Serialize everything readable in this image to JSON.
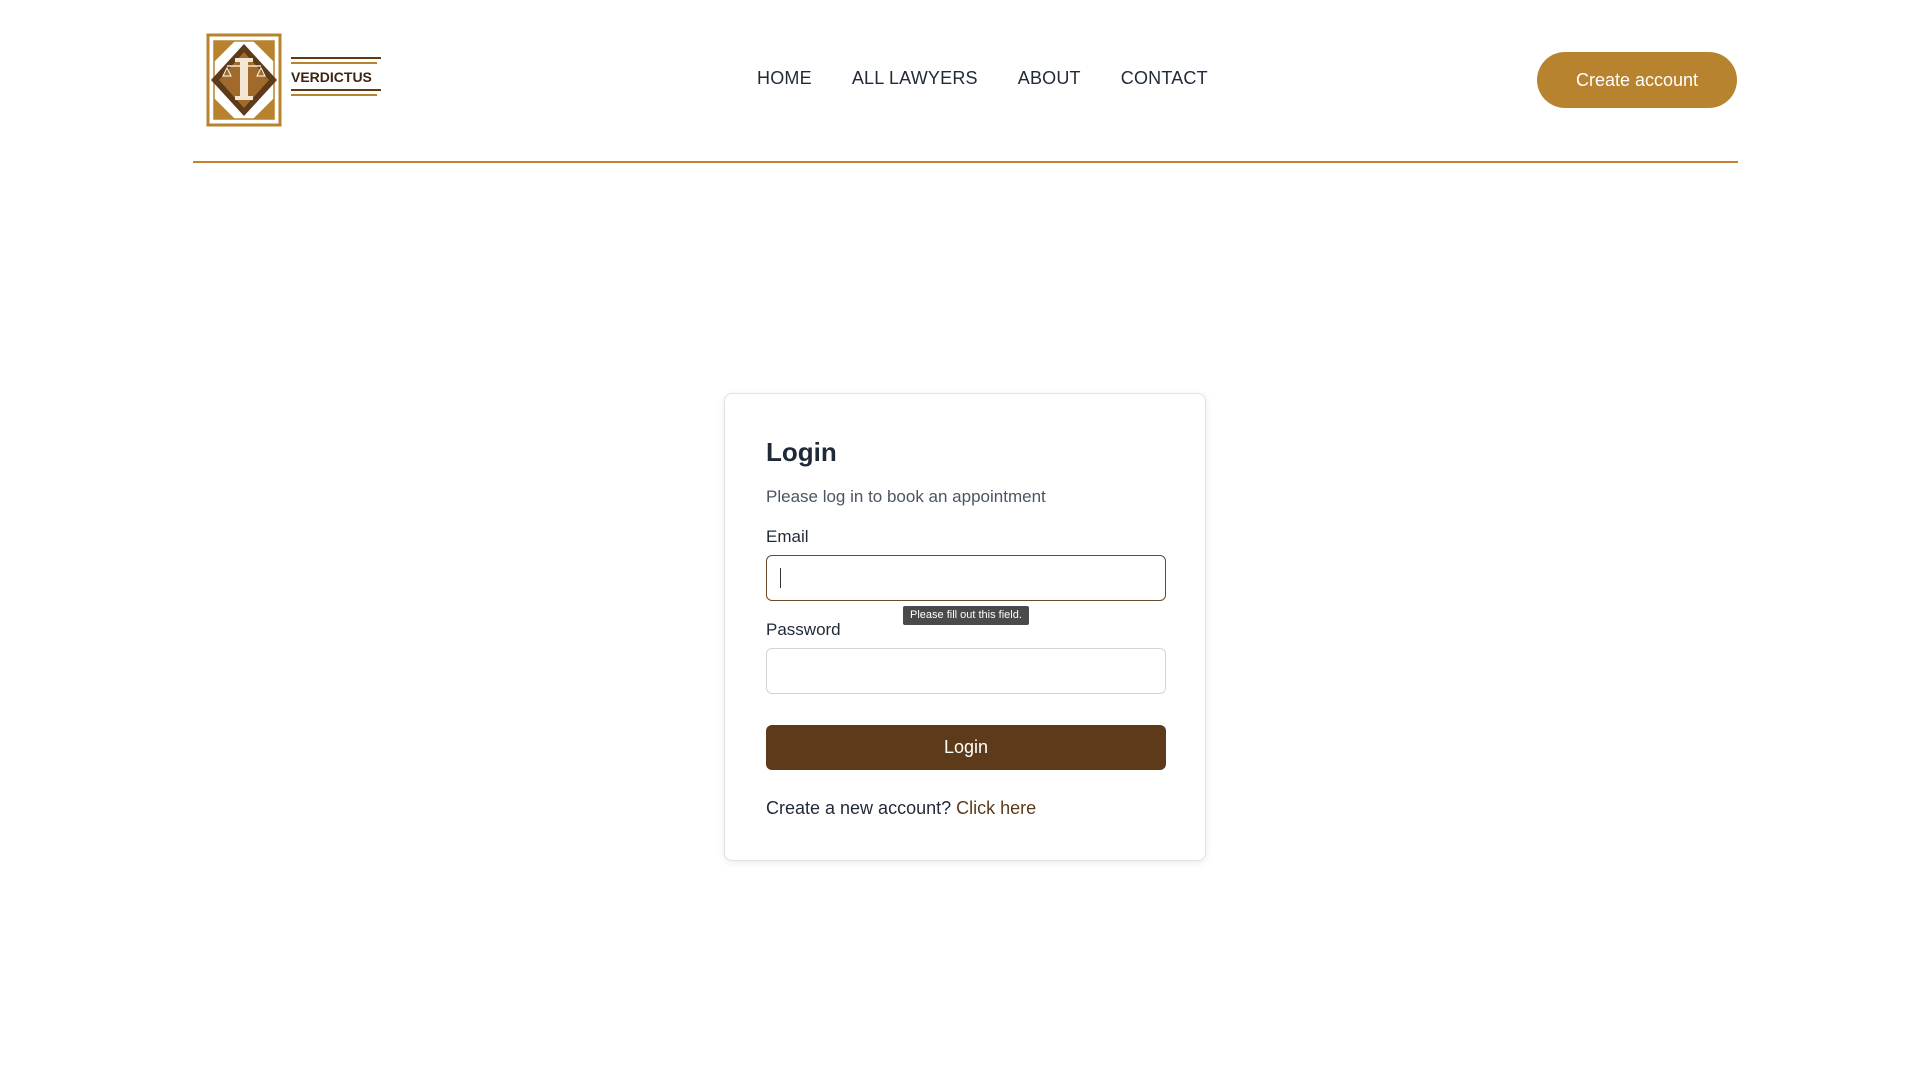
{
  "header": {
    "logo_text": "VERDICTUS",
    "nav": [
      {
        "label": "HOME"
      },
      {
        "label": "ALL LAWYERS"
      },
      {
        "label": "ABOUT"
      },
      {
        "label": "CONTACT"
      }
    ],
    "create_account_label": "Create account"
  },
  "login": {
    "title": "Login",
    "subtitle": "Please log in to book an appointment",
    "email_label": "Email",
    "email_value": "",
    "password_label": "Password",
    "password_value": "",
    "validation_tooltip": "Please fill out this field.",
    "submit_label": "Login",
    "signup_prompt": "Create a new account?",
    "signup_link": "Click here"
  },
  "colors": {
    "brand_gold": "#b7832f",
    "brand_brown": "#5d3a1a",
    "divider_orange": "#c7812e"
  }
}
